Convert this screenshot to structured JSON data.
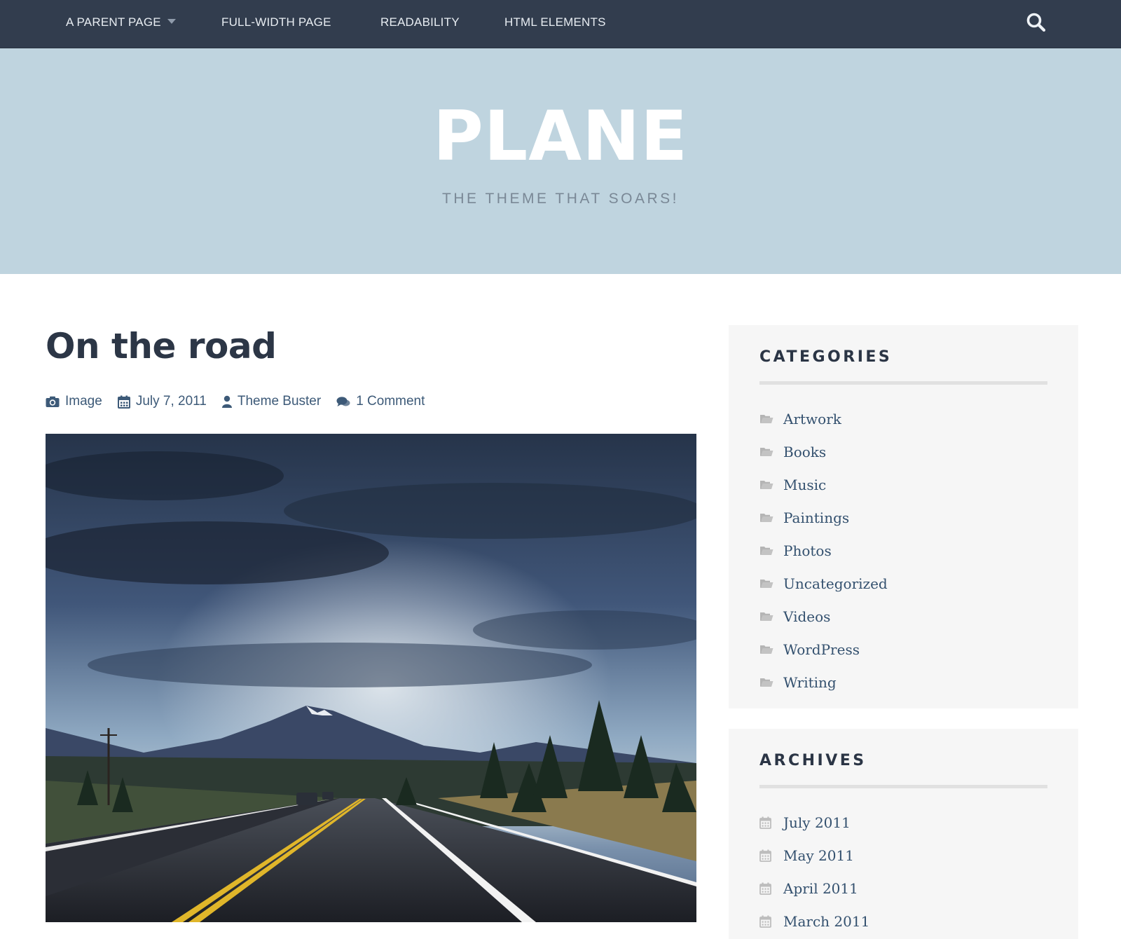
{
  "nav": {
    "items": [
      {
        "label": "A PARENT PAGE",
        "has_dropdown": true
      },
      {
        "label": "FULL-WIDTH PAGE"
      },
      {
        "label": "READABILITY"
      },
      {
        "label": "HTML ELEMENTS"
      }
    ],
    "search_icon": "search-icon"
  },
  "header": {
    "title": "PLANE",
    "tagline": "THE THEME THAT SOARS!"
  },
  "post": {
    "title": "On the road",
    "meta": {
      "format": "Image",
      "date": "July 7, 2011",
      "author": "Theme Buster",
      "comments": "1 Comment"
    },
    "image_icon": "camera-icon"
  },
  "sidebar": {
    "categories": {
      "title": "CATEGORIES",
      "items": [
        "Artwork",
        "Books",
        "Music",
        "Paintings",
        "Photos",
        "Uncategorized",
        "Videos",
        "WordPress",
        "Writing"
      ]
    },
    "archives": {
      "title": "ARCHIVES",
      "items": [
        "July 2011",
        "May 2011",
        "April 2011",
        "March 2011"
      ]
    }
  },
  "colors": {
    "nav_bg": "#323d4e",
    "header_bg": "#bfd4df",
    "link": "#33506e",
    "widget_bg": "#f6f6f6"
  }
}
